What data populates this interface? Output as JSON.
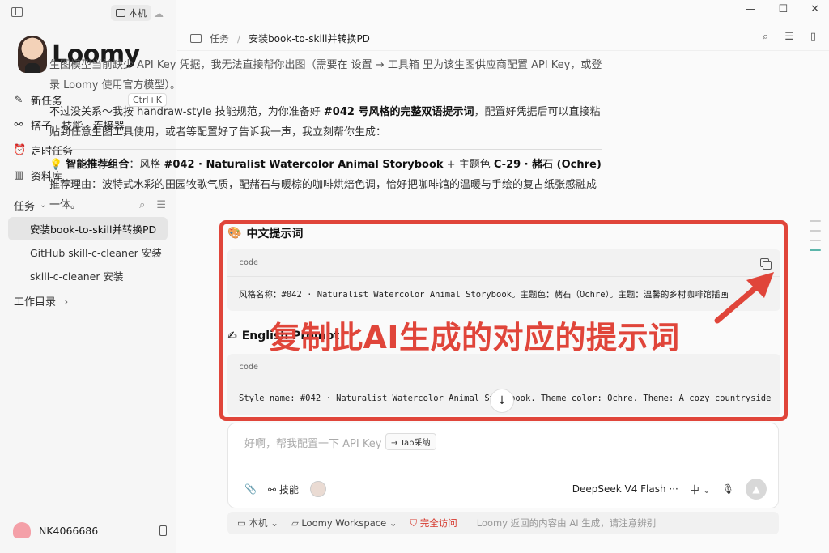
{
  "sidebar": {
    "local_label": "本机",
    "logo_text": "Loomy",
    "nav": [
      {
        "icon": "edit-icon",
        "glyph": "✎",
        "label": "新任务",
        "shortcut": "Ctrl+K"
      },
      {
        "icon": "connector-icon",
        "glyph": "⚯",
        "label": "搭子 · 技能 · 连接器"
      },
      {
        "icon": "alarm-icon",
        "glyph": "⏰",
        "label": "定时任务"
      },
      {
        "icon": "library-icon",
        "glyph": "▥",
        "label": "资料库"
      }
    ],
    "tasks_label": "任务",
    "tasks": [
      {
        "label": "安装book-to-skill并转换PD",
        "active": true
      },
      {
        "label": "GitHub skill-c-cleaner 安装"
      },
      {
        "label": "skill-c-cleaner 安装"
      }
    ],
    "workdir_label": "工作目录",
    "user_name": "NK4066686"
  },
  "header": {
    "crumb_root": "任务",
    "crumb_current": "安装book-to-skill并转换PD"
  },
  "content": {
    "p1": "生图模型当前缺少 API Key 凭据，我无法直接帮你出图（需要在 设置 → 工具箱 里为该生图供应商配置 API Key，或登录 Loomy 使用官方模型）。",
    "p2_pre": "不过没关系～我按 handraw-style 技能规范，为你准备好 ",
    "p2_bold": "#042 号风格的完整双语提示词",
    "p2_post": "，配置好凭据后可以直接粘贴到任意生图工具使用，或者等配置好了告诉我一声，我立刻帮你生成：",
    "rec_label": "智能推荐组合",
    "rec_mid": "：风格 ",
    "rec_style": "#042 · Naturalist Watercolor Animal Storybook",
    "rec_plus": " + 主题色 ",
    "rec_color": "C-29 · 赭石 (Ochre)",
    "reason": "推荐理由：波特式水彩的田园牧歌气质，配赭石与暖棕的咖啡烘焙色调，恰好把咖啡馆的温暖与手绘的复古纸张感融成一体。",
    "zh_heading": "中文提示词",
    "en_heading": "English Prompt",
    "code_label": "code",
    "zh_code": "风格名称：#042 · Naturalist Watercolor Animal Storybook。主题色：赭石（Ochre）。主题：温馨的乡村咖啡馆插画",
    "en_code": "Style name: #042 · Naturalist Watercolor Animal Storybook. Theme color: Ochre. Theme: A cozy countryside"
  },
  "overlay": {
    "annotation": "复制此AI生成的对应的提示词",
    "color": "#e0453a"
  },
  "composer": {
    "placeholder": "好啊，帮我配置一下 API Key",
    "tab_hint": "→ Tab采纳",
    "skills_label": "技能",
    "model": "DeepSeek V4 Flash ···",
    "lang": "中"
  },
  "statusbar": {
    "machine": "本机",
    "workspace": "Loomy Workspace",
    "access": "完全访问",
    "disclaimer": "Loomy 返回的内容由 AI 生成，请注意辨别"
  }
}
